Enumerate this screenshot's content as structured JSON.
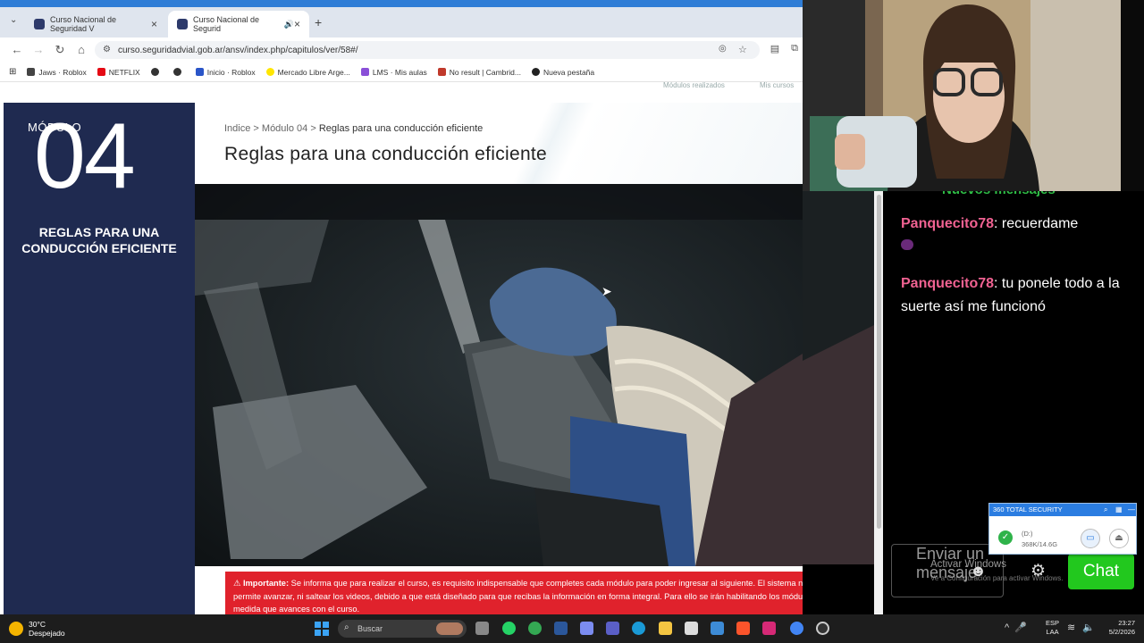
{
  "browser": {
    "tabs": [
      {
        "title": "Curso Nacional de Seguridad V"
      },
      {
        "title": "Curso Nacional de Segurid"
      }
    ],
    "url": "curso.seguridadvial.gob.ar/ansv/index.php/capitulos/ver/58#/",
    "bookmarks": [
      {
        "label": "Jaws · Roblox"
      },
      {
        "label": "NETFLIX"
      },
      {
        "label": "Inicio · Roblox"
      },
      {
        "label": "Mercado Libre Arge..."
      },
      {
        "label": "LMS · Mis aulas"
      },
      {
        "label": "No result | Cambrid..."
      },
      {
        "label": "Nueva pestaña"
      }
    ]
  },
  "site": {
    "top_links": [
      "Módulos realizados",
      "Mis cursos"
    ],
    "sidebar": {
      "label": "MÓDULO",
      "number": "04",
      "title": "REGLAS PARA UNA CONDUCCIÓN EFICIENTE"
    },
    "breadcrumb": {
      "root": "Indice",
      "sep1": " > ",
      "module": "Módulo 04",
      "sep2": " > ",
      "current": "Reglas para una conducción eficiente"
    },
    "page_title": "Reglas para una conducción eficiente",
    "alert": {
      "strong": "Importante:",
      "text": "Se informa que para realizar el curso, es requisito indispensable que completes cada módulo para poder ingresar al siguiente. El sistema no permite avanzar, ni saltear los videos, debido a que está diseñado para que recibas la información en forma integral. Para ello se irán habilitando los módulos a medida que avances con el curso."
    }
  },
  "chat": {
    "header_partial": "Nuevos mensajes",
    "messages": [
      {
        "user": "Panquecito78",
        "text": "recuerdame"
      },
      {
        "user": "Panquecito78",
        "text": "tu ponele todo a la suerte así me funcionó"
      }
    ],
    "input_placeholder": "Enviar un mensaje",
    "send_label": "Chat"
  },
  "windows_watermark": {
    "line1": "Activar Windows",
    "line2": "Ve a Configuración para activar Windows."
  },
  "security_widget": {
    "title": "360 TOTAL SECURITY",
    "drive": "(D:)",
    "usage": "368K/14.6G"
  },
  "taskbar": {
    "temperature": "30°C",
    "weather": "Despejado",
    "search_placeholder": "Buscar",
    "language": "ESP",
    "layout": "LAA",
    "time": "23:27",
    "date": "5/2/2026"
  },
  "colors": {
    "sidebar_bg": "#1f2a50",
    "alert_bg": "#e0222c",
    "chat_user": "#f06292",
    "chat_button": "#22c81e"
  }
}
